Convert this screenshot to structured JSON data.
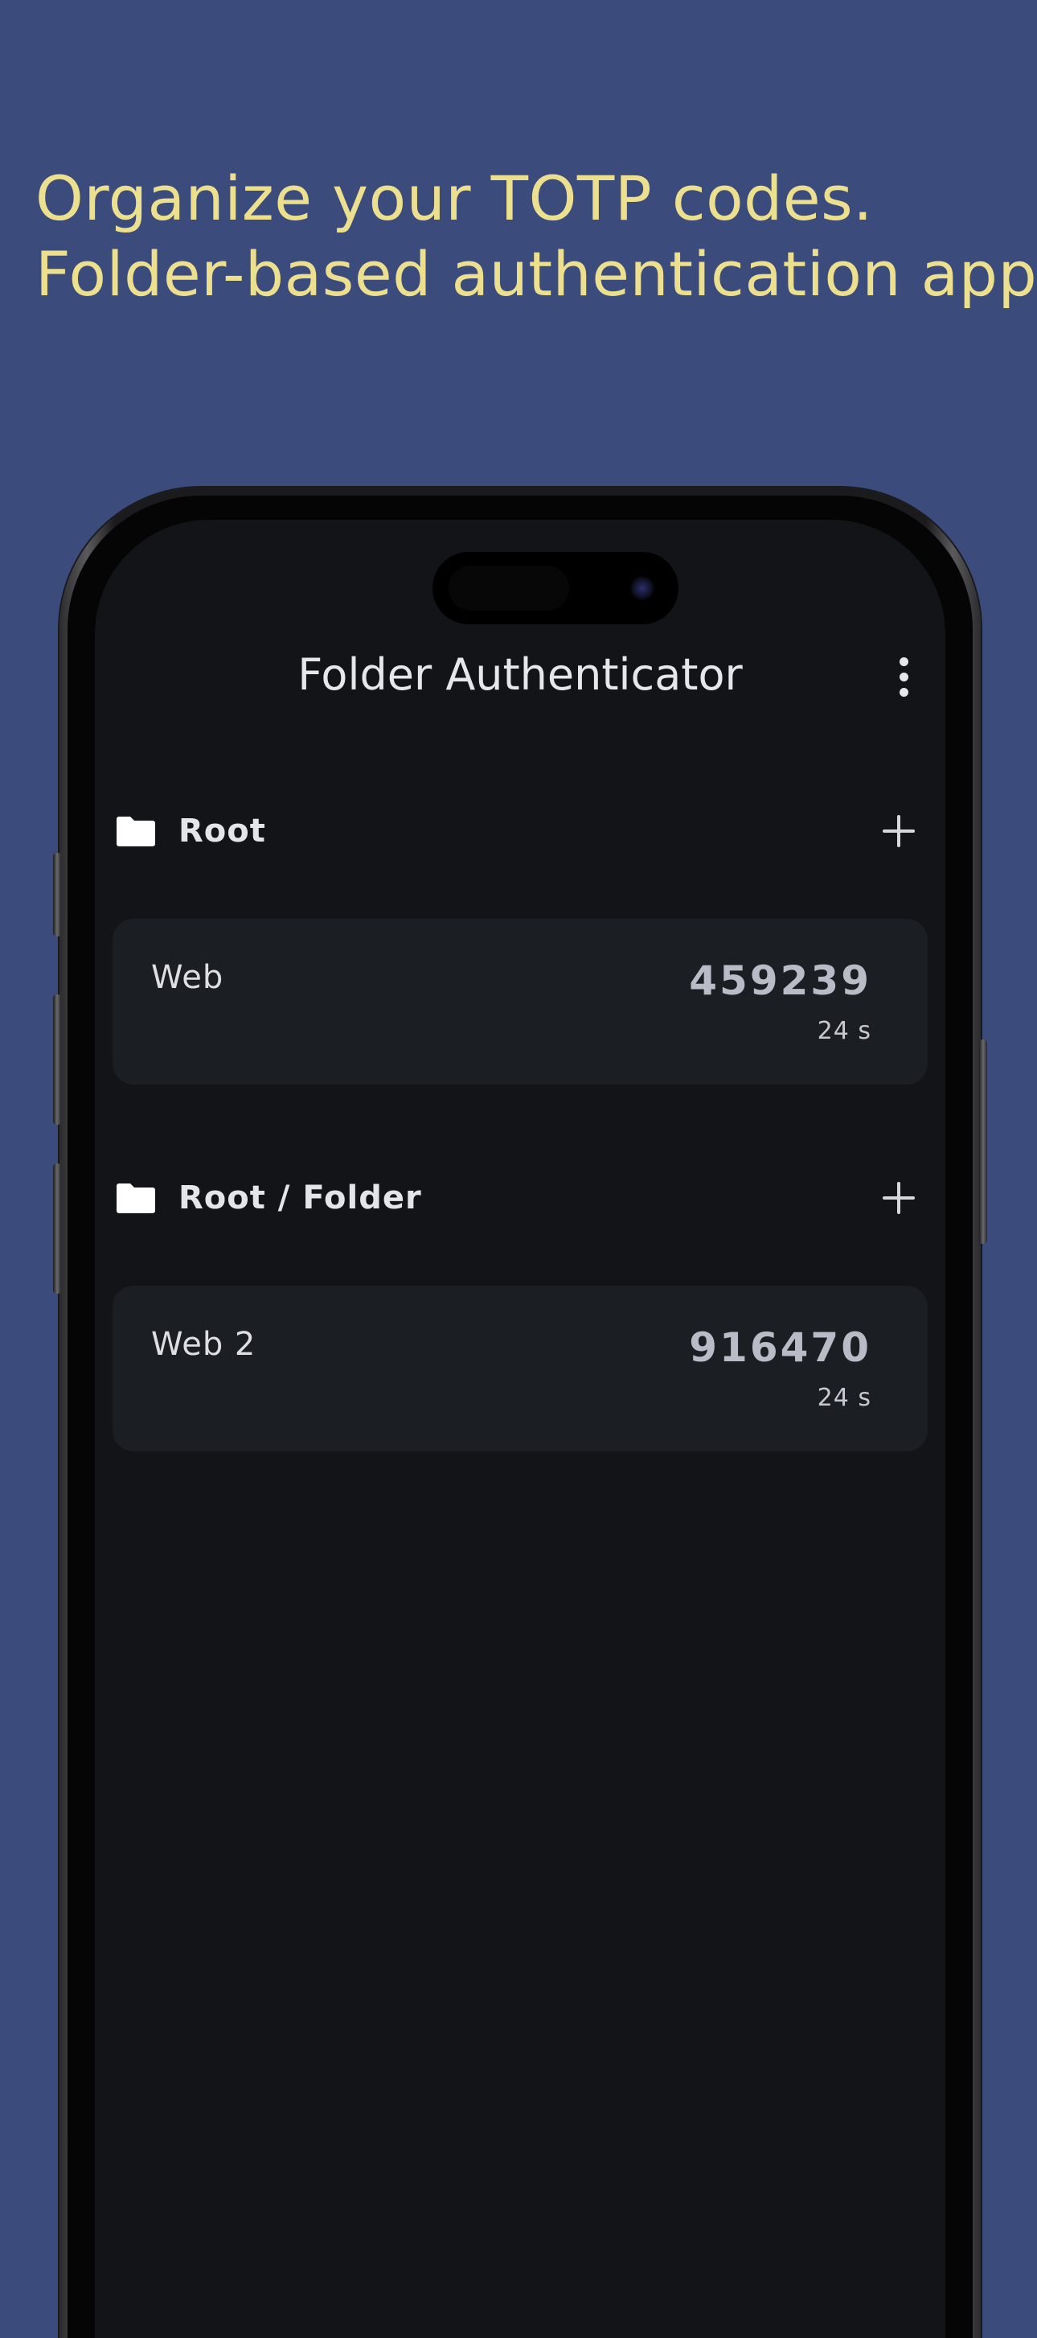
{
  "headline": {
    "line1": "Organize your TOTP codes.",
    "line2": "Folder-based authentication app"
  },
  "app": {
    "title": "Folder Authenticator",
    "more_menu_icon": "more-vert-icon"
  },
  "folders": [
    {
      "name": "Root",
      "icon": "folder-icon",
      "add_icon": "plus-icon",
      "entries": [
        {
          "account": "Web",
          "code": "459239",
          "remaining": "24 s"
        }
      ]
    },
    {
      "name": "Root / Folder",
      "icon": "folder-icon",
      "add_icon": "plus-icon",
      "entries": [
        {
          "account": "Web 2",
          "code": "916470",
          "remaining": "24 s"
        }
      ]
    }
  ],
  "colors": {
    "background": "#3b4b7c",
    "headline": "#ecdf8e",
    "screen": "#121418",
    "card": "#1b1e23"
  }
}
